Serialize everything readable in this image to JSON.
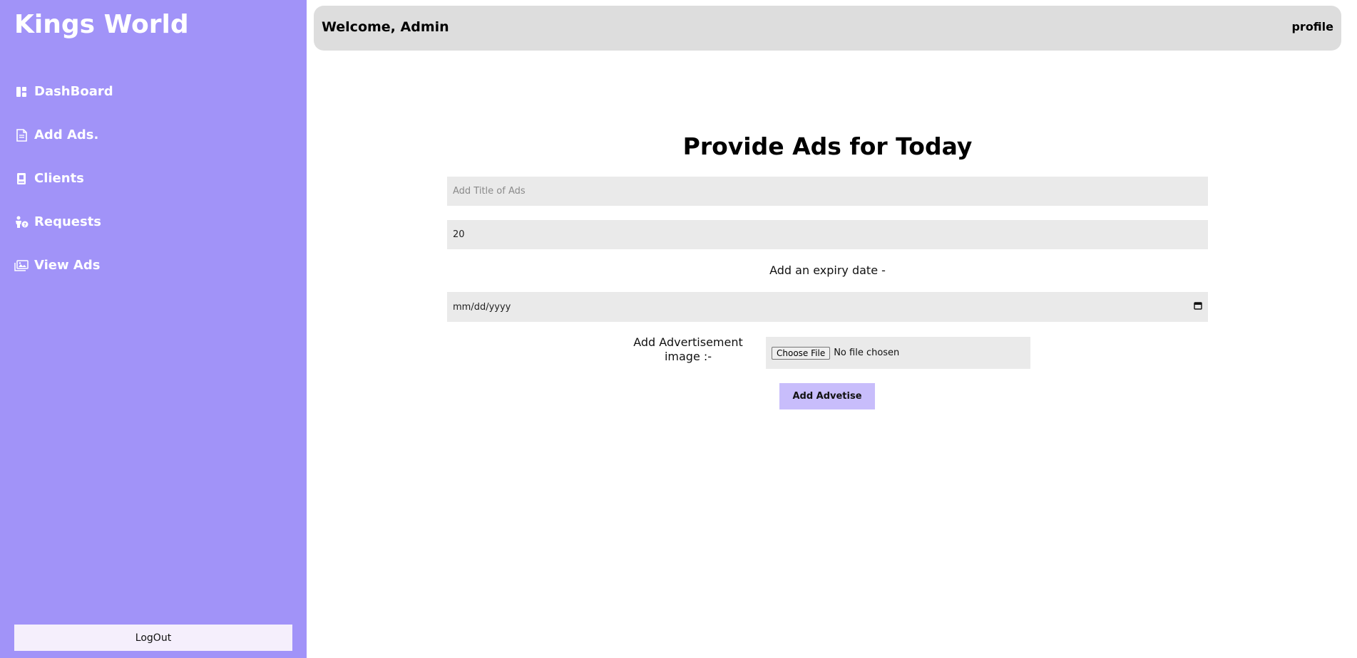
{
  "sidebar": {
    "brand": "Kings World",
    "items": [
      {
        "label": "DashBoard",
        "icon": "dashboard-icon"
      },
      {
        "label": "Add Ads.",
        "icon": "document-icon"
      },
      {
        "label": "Clients",
        "icon": "contact-book-icon"
      },
      {
        "label": "Requests",
        "icon": "person-request-icon"
      },
      {
        "label": "View Ads",
        "icon": "images-icon"
      }
    ],
    "logout_label": "LogOut"
  },
  "header": {
    "welcome": "Welcome, Admin",
    "profile_label": "profile"
  },
  "form": {
    "heading": "Provide Ads for Today",
    "title_placeholder": "Add Title of Ads",
    "number_value": "20",
    "expiry_label": "Add an expiry date -",
    "date_placeholder": "mm/dd/yyyy",
    "image_label": "Add Advertisement image :-",
    "choose_file_label": "Choose File",
    "file_status": "No file chosen",
    "submit_label": "Add Advetise"
  },
  "colors": {
    "sidebar_bg": "#a193f8",
    "header_bg": "#dddddd",
    "input_bg": "#eaeaea",
    "submit_bg": "#c8bdfb",
    "logout_bg": "#f5effc"
  }
}
